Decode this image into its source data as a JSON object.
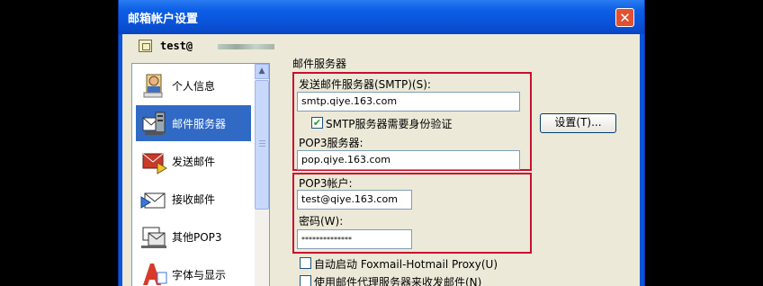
{
  "window": {
    "title": "邮箱帐户设置",
    "close_symbol": "✕"
  },
  "account": {
    "name": "test@"
  },
  "nav": {
    "items": [
      {
        "label": "个人信息",
        "icon": "person-icon"
      },
      {
        "label": "邮件服务器",
        "icon": "mail-server-icon"
      },
      {
        "label": "发送邮件",
        "icon": "send-mail-icon"
      },
      {
        "label": "接收邮件",
        "icon": "receive-mail-icon"
      },
      {
        "label": "其他POP3",
        "icon": "pop3-icon"
      },
      {
        "label": "字体与显示",
        "icon": "font-icon"
      }
    ],
    "selected_index": 1,
    "scroll_up_symbol": "▲"
  },
  "section": {
    "title": "邮件服务器"
  },
  "smtp": {
    "label": "发送邮件服务器(SMTP)(S):",
    "value": "smtp.qiye.163.com",
    "auth_checkbox_label": "SMTP服务器需要身份验证",
    "auth_checked": true,
    "check_mark": "✔",
    "settings_button": "设置(T)..."
  },
  "pop3": {
    "server_label": "POP3服务器:",
    "server_value": "pop.qiye.163.com",
    "account_label": "POP3帐户:",
    "account_value": "test@qiye.163.com",
    "password_label": "密码(W):",
    "password_value": "**************"
  },
  "options": {
    "proxy_auto_label": "自动启动 Foxmail-Hotmail Proxy(U)",
    "proxy_auto_checked": false,
    "use_proxy_label": "使用邮件代理服务器来收发邮件(N)",
    "use_proxy_checked": false
  },
  "colors": {
    "title_bar": "#0a55d8",
    "selection": "#316ac5",
    "highlight_box": "#c8102e",
    "dialog_bg": "#ece9d8"
  }
}
